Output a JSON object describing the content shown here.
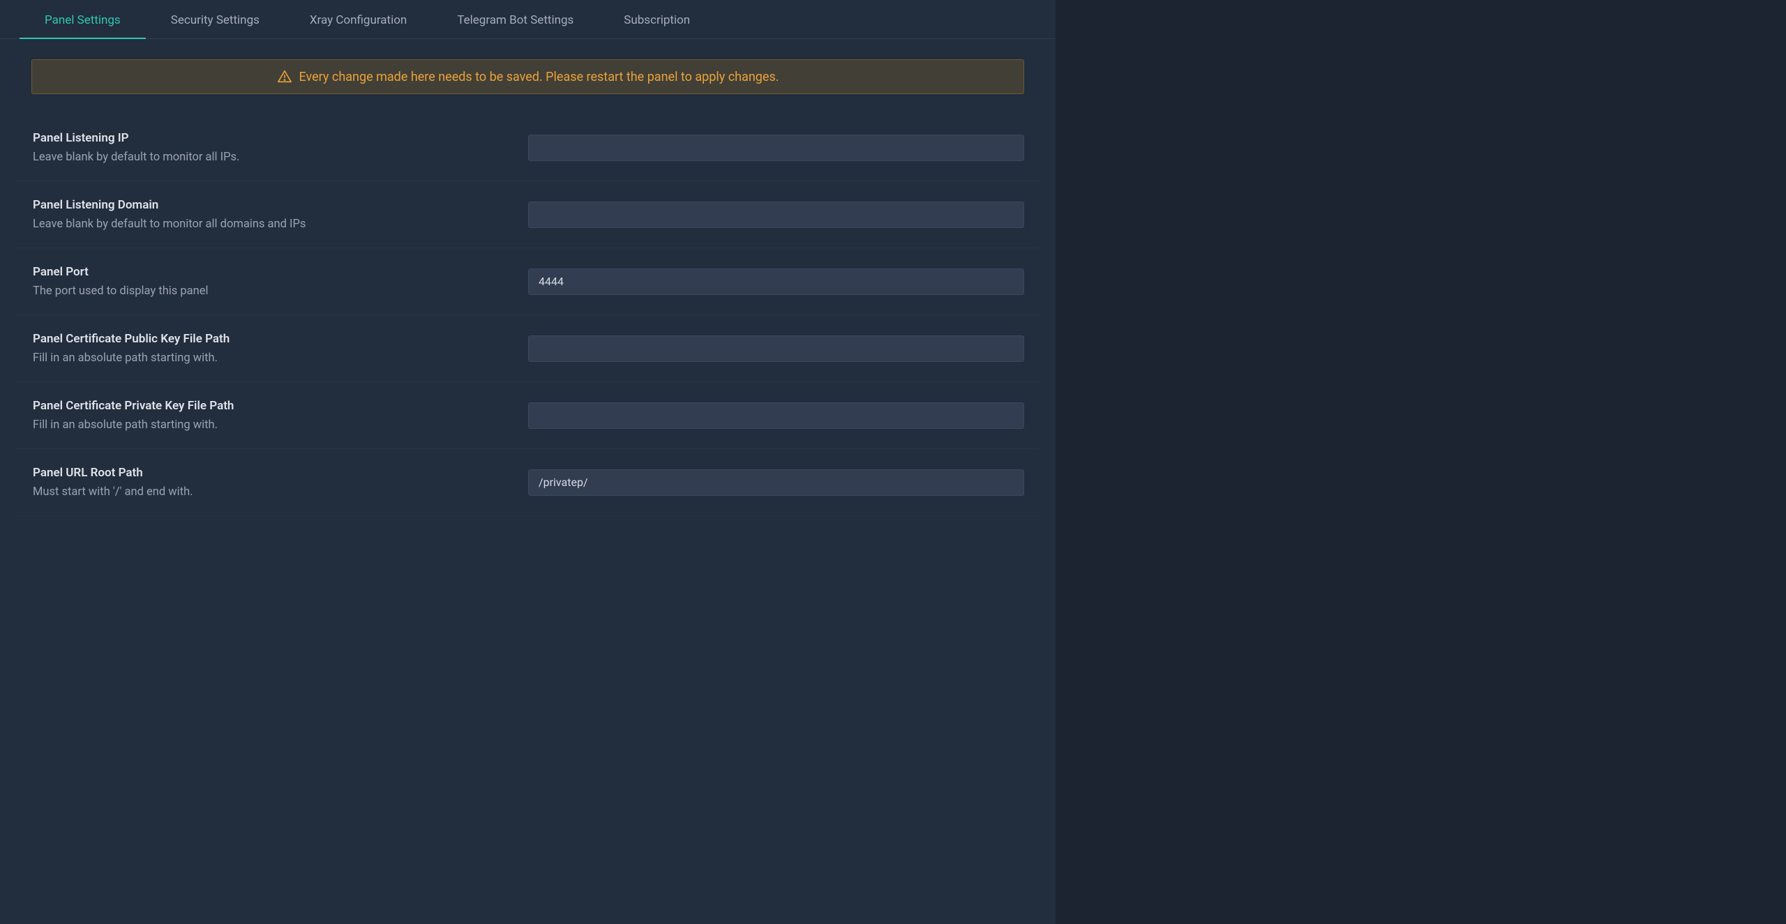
{
  "tabs": [
    {
      "label": "Panel Settings",
      "active": true
    },
    {
      "label": "Security Settings",
      "active": false
    },
    {
      "label": "Xray Configuration",
      "active": false
    },
    {
      "label": "Telegram Bot Settings",
      "active": false
    },
    {
      "label": "Subscription",
      "active": false
    }
  ],
  "alert": {
    "text": "Every change made here needs to be saved. Please restart the panel to apply changes."
  },
  "settings": [
    {
      "key": "listening-ip",
      "title": "Panel Listening IP",
      "desc": "Leave blank by default to monitor all IPs.",
      "value": ""
    },
    {
      "key": "listening-domain",
      "title": "Panel Listening Domain",
      "desc": "Leave blank by default to monitor all domains and IPs",
      "value": ""
    },
    {
      "key": "port",
      "title": "Panel Port",
      "desc": "The port used to display this panel",
      "value": "4444"
    },
    {
      "key": "cert-public-key",
      "title": "Panel Certificate Public Key File Path",
      "desc": "Fill in an absolute path starting with.",
      "value": ""
    },
    {
      "key": "cert-private-key",
      "title": "Panel Certificate Private Key File Path",
      "desc": "Fill in an absolute path starting with.",
      "value": ""
    },
    {
      "key": "url-root-path",
      "title": "Panel URL Root Path",
      "desc": "Must start with '/' and end with.",
      "value": "/privatep/"
    }
  ]
}
